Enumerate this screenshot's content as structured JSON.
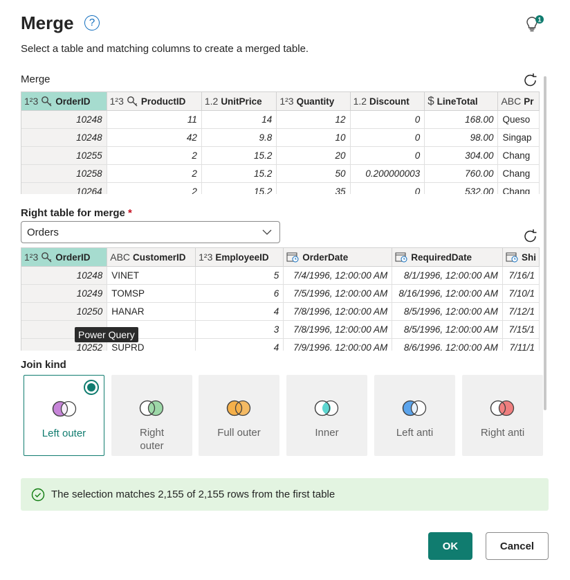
{
  "header": {
    "title": "Merge",
    "help_icon": "question-circle-icon",
    "bulb_icon": "lightbulb-icon",
    "bulb_badge": "1"
  },
  "subtitle": "Select a table and matching columns to create a merged table.",
  "merge_section": {
    "label": "Merge",
    "columns": [
      {
        "type": "1²3",
        "key": true,
        "name": "OrderID",
        "selected": true
      },
      {
        "type": "1²3",
        "key": true,
        "name": "ProductID"
      },
      {
        "type": "1.2",
        "name": "UnitPrice"
      },
      {
        "type": "1²3",
        "name": "Quantity"
      },
      {
        "type": "1.2",
        "name": "Discount"
      },
      {
        "type": "$",
        "name": "LineTotal"
      },
      {
        "type": "ABC",
        "name": "Pr"
      }
    ],
    "rows": [
      [
        "10248",
        "11",
        "14",
        "12",
        "0",
        "168.00",
        "Queso"
      ],
      [
        "10248",
        "42",
        "9.8",
        "10",
        "0",
        "98.00",
        "Singap"
      ],
      [
        "10255",
        "2",
        "15.2",
        "20",
        "0",
        "304.00",
        "Chang"
      ],
      [
        "10258",
        "2",
        "15.2",
        "50",
        "0.200000003",
        "760.00",
        "Chang"
      ],
      [
        "10264",
        "2",
        "15.2",
        "35",
        "0",
        "532.00",
        "Chang"
      ]
    ]
  },
  "right_table": {
    "label": "Right table for merge",
    "required_mark": "*",
    "selected": "Orders",
    "columns": [
      {
        "type": "1²3",
        "key": true,
        "name": "OrderID",
        "selected": true
      },
      {
        "type": "ABC",
        "name": "CustomerID"
      },
      {
        "type": "1²3",
        "name": "EmployeeID"
      },
      {
        "type": "cal",
        "name": "OrderDate"
      },
      {
        "type": "cal",
        "name": "RequiredDate"
      },
      {
        "type": "cal",
        "name": "Shi"
      }
    ],
    "rows": [
      [
        "10248",
        "VINET",
        "5",
        "7/4/1996, 12:00:00 AM",
        "8/1/1996, 12:00:00 AM",
        "7/16/1"
      ],
      [
        "10249",
        "TOMSP",
        "6",
        "7/5/1996, 12:00:00 AM",
        "8/16/1996, 12:00:00 AM",
        "7/10/1"
      ],
      [
        "10250",
        "HANAR",
        "4",
        "7/8/1996, 12:00:00 AM",
        "8/5/1996, 12:00:00 AM",
        "7/12/1"
      ],
      [
        "",
        "",
        "3",
        "7/8/1996, 12:00:00 AM",
        "8/5/1996, 12:00:00 AM",
        "7/15/1"
      ],
      [
        "10252",
        "SUPRD",
        "4",
        "7/9/1996, 12:00:00 AM",
        "8/6/1996, 12:00:00 AM",
        "7/11/1"
      ]
    ]
  },
  "tooltip": "Power Query",
  "join_kind": {
    "label": "Join kind",
    "selected": "Left outer",
    "options": [
      {
        "label": "Left outer",
        "left": "#c785d9",
        "right": "#ffffff"
      },
      {
        "label": "Right outer",
        "left": "#ffffff",
        "right": "#8ed39b"
      },
      {
        "label": "Full outer",
        "left": "#f5b04a",
        "right": "#f5b04a"
      },
      {
        "label": "Inner",
        "left": "#ffffff",
        "right": "#ffffff",
        "inner": "#5cd6d0"
      },
      {
        "label": "Left anti",
        "left": "#5ba4ec",
        "right": "#ffffff"
      },
      {
        "label": "Right anti",
        "left": "#ffffff",
        "right": "#ee6b6b"
      }
    ]
  },
  "status": {
    "icon": "check-circle-icon",
    "text": "The selection matches 2,155 of 2,155 rows from the first table"
  },
  "buttons": {
    "ok": "OK",
    "cancel": "Cancel"
  },
  "colors": {
    "accent": "#107c6f",
    "selected_header": "#a6dccf",
    "status_bg": "#e3f4e1"
  }
}
